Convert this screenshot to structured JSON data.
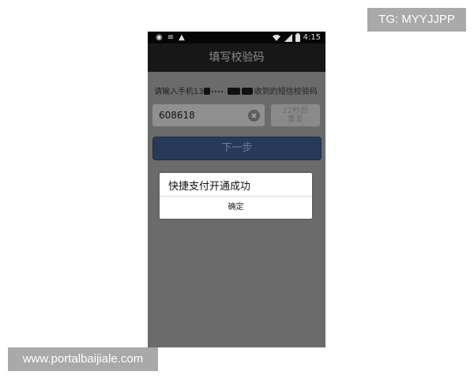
{
  "watermarks": {
    "top": "TG: MYYJJPP",
    "bottom": "www.portalbaijiale.com"
  },
  "status_bar": {
    "time": "4:15",
    "left_icons": [
      "notification-app-icon",
      "menu-icon",
      "warning-icon"
    ],
    "right_icons": [
      "wifi-icon",
      "signal-icon",
      "battery-icon"
    ]
  },
  "header": {
    "title": "填写校验码"
  },
  "form": {
    "prompt_prefix": "请输入手机13",
    "prompt_suffix": "收到的短信校验码",
    "code_value": "608618",
    "resend_label": "22秒后重发",
    "next_label": "下一步"
  },
  "dialog": {
    "message": "快捷支付开通成功",
    "confirm_label": "确定"
  }
}
